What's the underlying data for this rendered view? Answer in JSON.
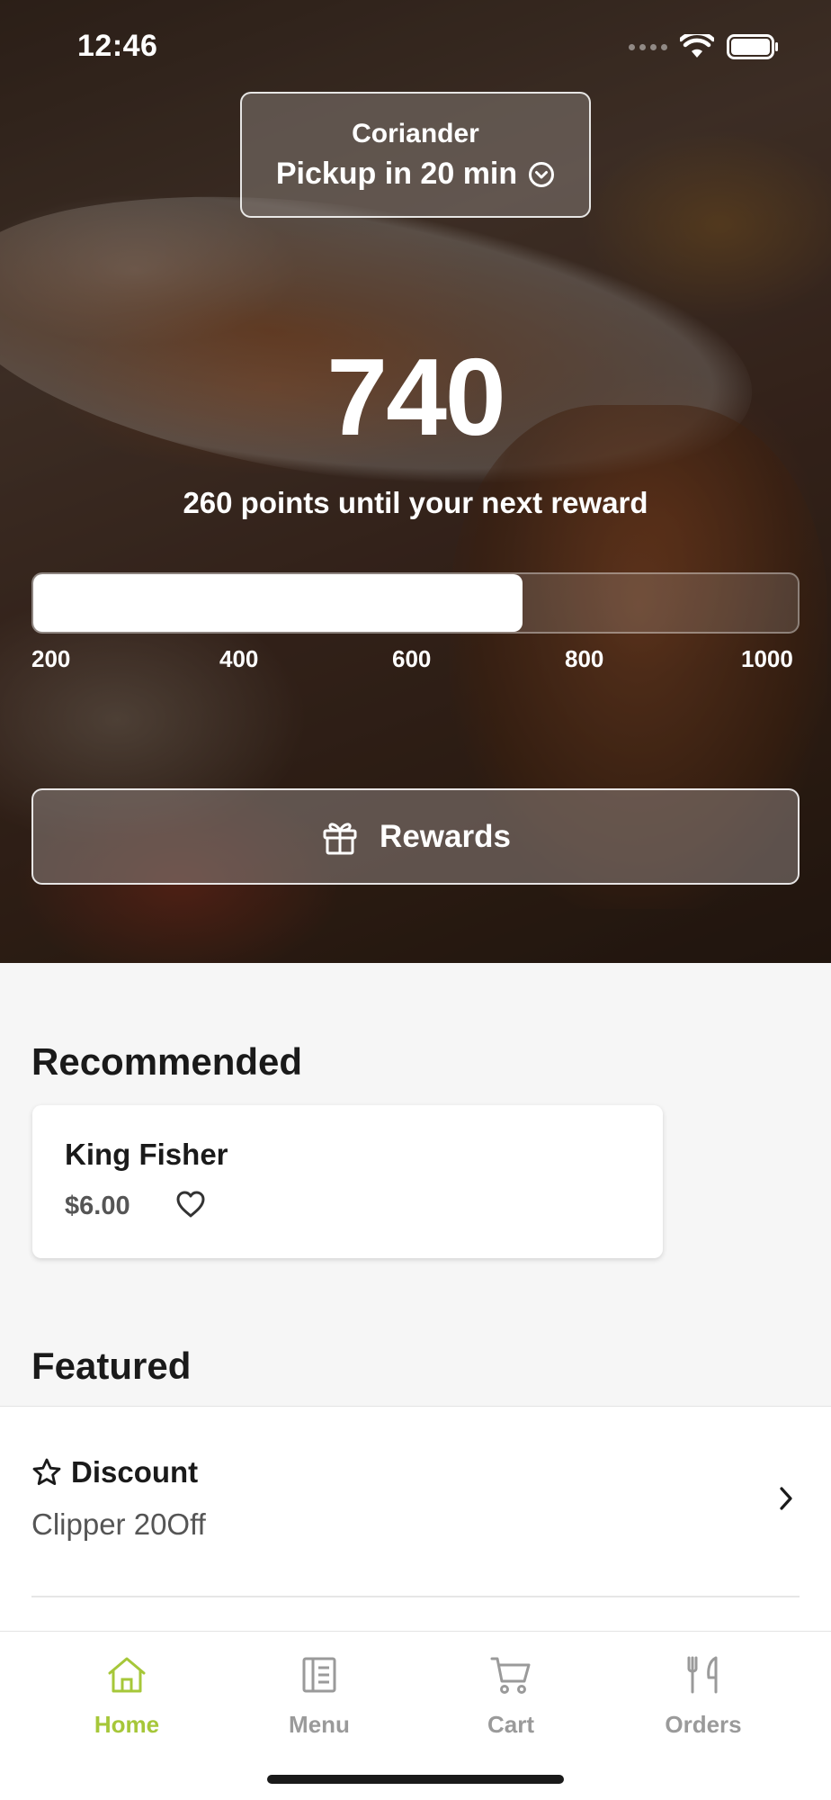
{
  "status_bar": {
    "time": "12:46"
  },
  "location": {
    "name": "Coriander",
    "pickup_label": "Pickup in 20 min"
  },
  "rewards": {
    "points": "740",
    "caption": "260 points until your next reward",
    "progress": {
      "value": 740,
      "min": 100,
      "max": 1000,
      "fraction": 0.64
    },
    "scale_labels": [
      "200",
      "400",
      "600",
      "800",
      "1000"
    ],
    "button_label": "Rewards"
  },
  "recommended": {
    "title": "Recommended",
    "items": [
      {
        "name": "King Fisher",
        "price": "$6.00"
      }
    ]
  },
  "featured": {
    "title": "Featured",
    "items": [
      {
        "label": "Discount",
        "subtitle": "Clipper 20Off"
      }
    ]
  },
  "tab_bar": {
    "accent_color": "#a6c739",
    "inactive_color": "#9a9a9a",
    "tabs": [
      {
        "label": "Home",
        "icon": "home-icon",
        "active": true
      },
      {
        "label": "Menu",
        "icon": "menu-icon",
        "active": false
      },
      {
        "label": "Cart",
        "icon": "cart-icon",
        "active": false
      },
      {
        "label": "Orders",
        "icon": "orders-icon",
        "active": false
      }
    ]
  }
}
